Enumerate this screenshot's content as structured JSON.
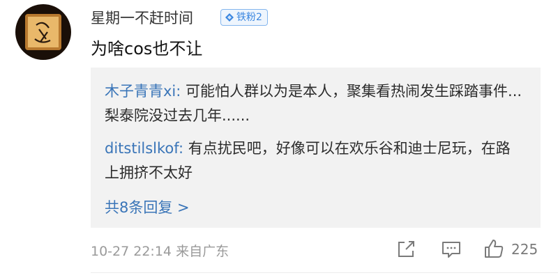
{
  "comment": {
    "username": "星期一不赶时间",
    "badge": "铁粉2",
    "text": "为啥cos也不让",
    "time": "10-27 22:14",
    "location": "来自广东",
    "like_count": "225"
  },
  "replies": [
    {
      "user": "木子青青xi",
      "sep": ": ",
      "text": "可能怕人群以为是本人，聚集看热闹发生踩踏事件...梨泰院没过去几年......"
    },
    {
      "user": "ditstilslkof",
      "sep": ": ",
      "text": "有点扰民吧，好像可以在欢乐谷和迪士尼玩，在路上拥挤不太好"
    }
  ],
  "more_replies": "共8条回复 >",
  "icons": [
    "avatar-image",
    "diamond-icon",
    "repost-icon",
    "comment-icon",
    "like-icon"
  ],
  "colors": {
    "link": "#3a75b8",
    "badge_border": "#84b6ee",
    "reply_bg": "#f2f2f2",
    "muted": "#9a9a9a"
  }
}
